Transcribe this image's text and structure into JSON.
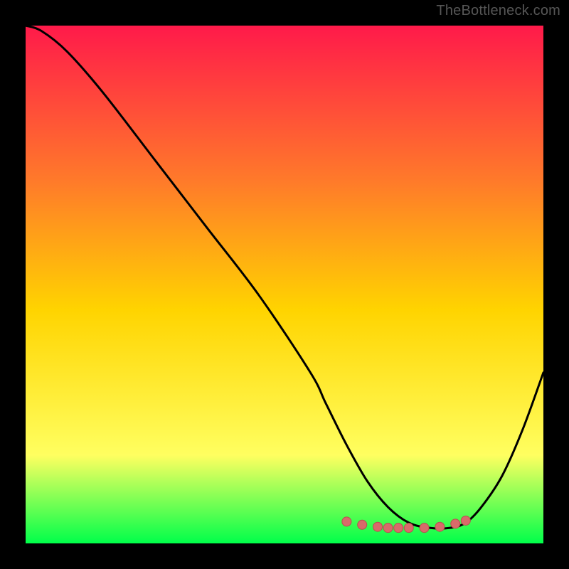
{
  "attribution": "TheBottleneck.com",
  "colors": {
    "background": "#000000",
    "gradient_top": "#ff1a4a",
    "gradient_mid_upper": "#ff7a2a",
    "gradient_mid": "#ffd400",
    "gradient_lower": "#ffff60",
    "gradient_bottom": "#00ff4a",
    "curve": "#000000",
    "marker_fill": "#d86a6a",
    "marker_stroke": "#b94f4f"
  },
  "chart_data": {
    "type": "line",
    "title": "",
    "xlabel": "",
    "ylabel": "",
    "xlim": [
      0,
      100
    ],
    "ylim": [
      0,
      100
    ],
    "grid": false,
    "series": [
      {
        "name": "bottleneck-curve",
        "x": [
          0,
          3,
          8,
          15,
          25,
          35,
          45,
          55,
          58,
          62,
          66,
          70,
          74,
          78,
          82,
          85,
          88,
          92,
          96,
          100
        ],
        "values": [
          100,
          99,
          95,
          87,
          74,
          61,
          48,
          33,
          27,
          19,
          12,
          7,
          4,
          3,
          3,
          4,
          7,
          13,
          22,
          33
        ]
      }
    ],
    "annotations": [
      {
        "name": "optimal-range-markers",
        "shape": "circle",
        "points": [
          {
            "x": 62,
            "y": 4.2
          },
          {
            "x": 65,
            "y": 3.6
          },
          {
            "x": 68,
            "y": 3.2
          },
          {
            "x": 70,
            "y": 3.0
          },
          {
            "x": 72,
            "y": 3.0
          },
          {
            "x": 74,
            "y": 3.0
          },
          {
            "x": 77,
            "y": 3.0
          },
          {
            "x": 80,
            "y": 3.2
          },
          {
            "x": 83,
            "y": 3.8
          },
          {
            "x": 85,
            "y": 4.4
          }
        ]
      }
    ]
  }
}
